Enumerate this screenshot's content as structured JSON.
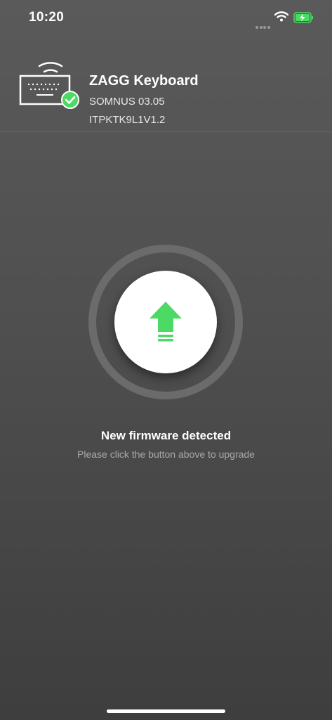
{
  "status_bar": {
    "time": "10:20",
    "icons": [
      "cellular-signal-icon",
      "wifi-icon",
      "battery-charging-icon"
    ],
    "battery_color": "#4cd964"
  },
  "device": {
    "name": "ZAGG Keyboard",
    "model": "SOMNUS 03.05",
    "firmware": "ITPKTK9L1V1.2",
    "icon": "keyboard-wireless-icon",
    "connected_badge_icon": "check-circle-icon",
    "connected_color": "#4cd964"
  },
  "upgrade": {
    "button_icon": "upload-arrow-icon",
    "accent_color": "#4cd964",
    "title": "New firmware detected",
    "hint": "Please click the button above to upgrade"
  }
}
